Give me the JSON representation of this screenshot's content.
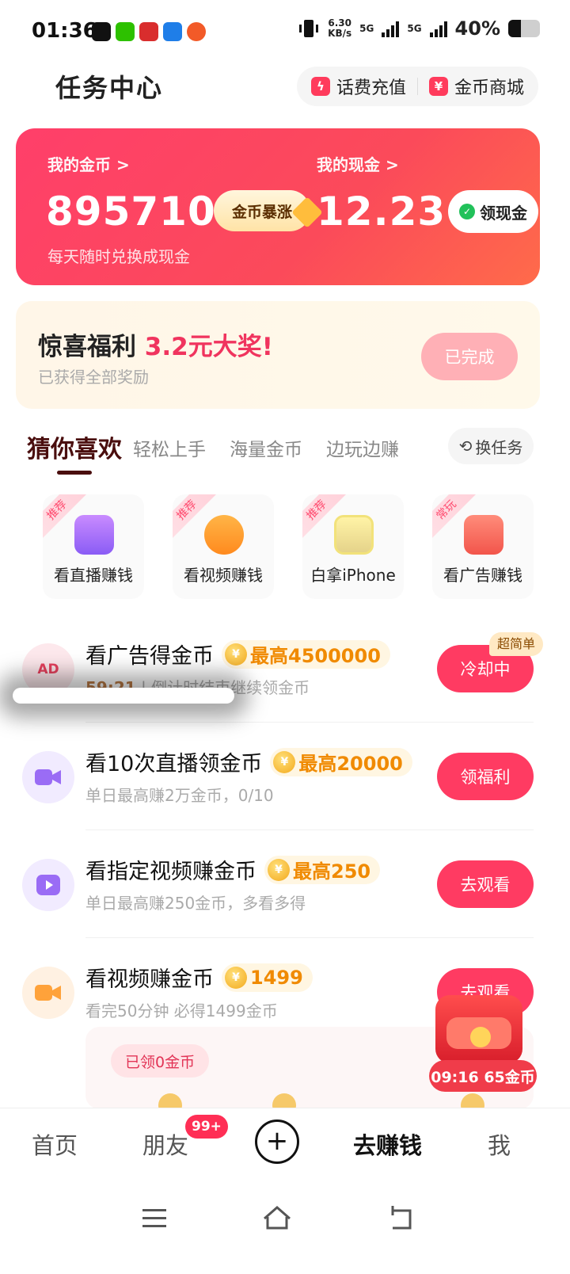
{
  "status_bar": {
    "time": "01:36",
    "net_speed": "6.30",
    "net_unit": "KB/s",
    "sig1": "5G",
    "sig2": "5G",
    "battery": "40%",
    "battery_level": 0.4
  },
  "header": {
    "title": "任务中心",
    "recharge": "话费充值",
    "mall": "金币商城"
  },
  "wallet": {
    "coins_label": "我的金币 >",
    "coins": "895710",
    "coins_promo": "金币暴涨",
    "cash_label": "我的现金 >",
    "cash": "12.23",
    "cash_btn": "领现金",
    "subtitle": "每天随时兑换成现金"
  },
  "bonus": {
    "title_a": "惊喜福利 ",
    "title_b": "3.2元大奖!",
    "subtitle": "已获得全部奖励",
    "button": "已完成"
  },
  "tabs": {
    "items": [
      "猜你喜欢",
      "轻松上手",
      "海量金币",
      "边玩边赚"
    ],
    "swap": "换任务"
  },
  "categories": [
    {
      "tag": "推荐",
      "label": "看直播赚钱",
      "icon": "live-tv-icon"
    },
    {
      "tag": "推荐",
      "label": "看视频赚钱",
      "icon": "video-camera-icon"
    },
    {
      "tag": "推荐",
      "label": "白拿iPhone",
      "icon": "iphone-icon"
    },
    {
      "tag": "常玩",
      "label": "看广告赚钱",
      "icon": "ad-tv-icon"
    }
  ],
  "tasks": [
    {
      "title": "看广告得金币",
      "reward": "最高4500000",
      "countdown": "59:21",
      "sub": "倒计时结束继续领金币",
      "button": "冷却中",
      "tag": "超简单",
      "icon_text": "AD"
    },
    {
      "title": "看10次直播领金币",
      "reward": "最高20000",
      "sub": "单日最高赚2万金币，0/10",
      "button": "领福利"
    },
    {
      "title": "看指定视频赚金币",
      "reward": "最高250",
      "sub": "单日最高赚250金币，多看多得",
      "button": "去观看"
    },
    {
      "title": "看视频赚金币",
      "reward": "1499",
      "sub": "看完50分钟 必得1499金币",
      "button": "去观看"
    }
  ],
  "panel": {
    "got": "已领0金币"
  },
  "gift": {
    "timer": "09:16 65金币"
  },
  "nav": {
    "home": "首页",
    "friends": "朋友",
    "friends_badge": "99+",
    "plus": "+",
    "earn": "去赚钱",
    "me": "我"
  },
  "colors": {
    "accent": "#ff3b62",
    "coin": "#f08a00",
    "tab_active": "#4a0e0e"
  }
}
